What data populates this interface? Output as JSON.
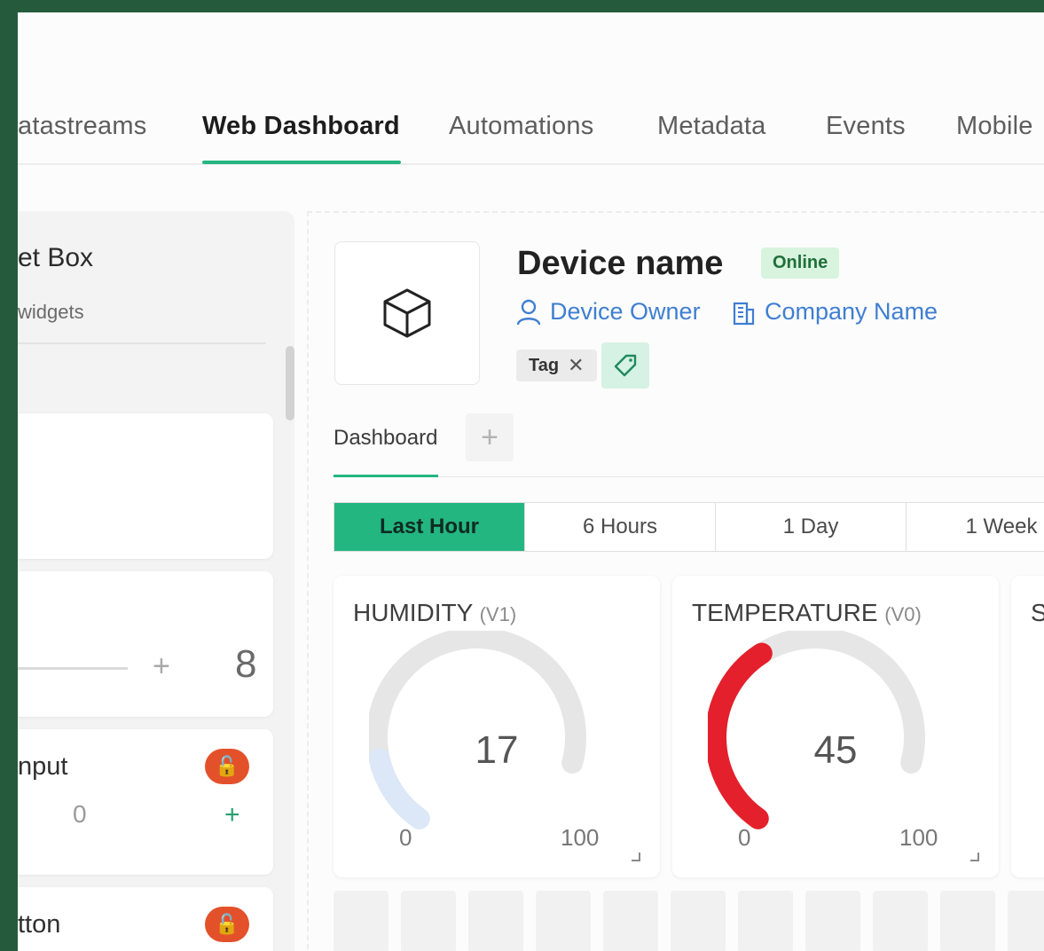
{
  "tabs": [
    {
      "label": "atastreams"
    },
    {
      "label": "Web Dashboard",
      "active": true
    },
    {
      "label": "Automations"
    },
    {
      "label": "Metadata"
    },
    {
      "label": "Events"
    },
    {
      "label": "Mobile"
    }
  ],
  "widget_box": {
    "title": "et Box",
    "subtitle": "widgets",
    "slider_value": "8",
    "input_label": "nput",
    "input_value": "0",
    "button_label": "tton"
  },
  "device": {
    "name": "Device name",
    "status": "Online",
    "owner": "Device Owner",
    "company": "Company Name",
    "tag": "Tag"
  },
  "dashboard": {
    "tab": "Dashboard",
    "time_ranges": [
      "Last Hour",
      "6 Hours",
      "1 Day",
      "1 Week"
    ],
    "active_range": "Last Hour"
  },
  "gauges": [
    {
      "title": "HUMIDITY",
      "pin": "(V1)",
      "value": "17",
      "min": "0",
      "max": "100",
      "fraction": 0.17,
      "color": "#dce8f7"
    },
    {
      "title": "TEMPERATURE",
      "pin": "(V0)",
      "value": "45",
      "min": "0",
      "max": "100",
      "fraction": 0.45,
      "color": "#e3202b"
    },
    {
      "title": "S",
      "pin": "",
      "value": "",
      "min": "",
      "max": "",
      "fraction": 0,
      "color": "#e6e6e6"
    }
  ],
  "colors": {
    "accent": "#23b681",
    "link": "#3f7ed1",
    "background_frame": "#255b3c"
  }
}
